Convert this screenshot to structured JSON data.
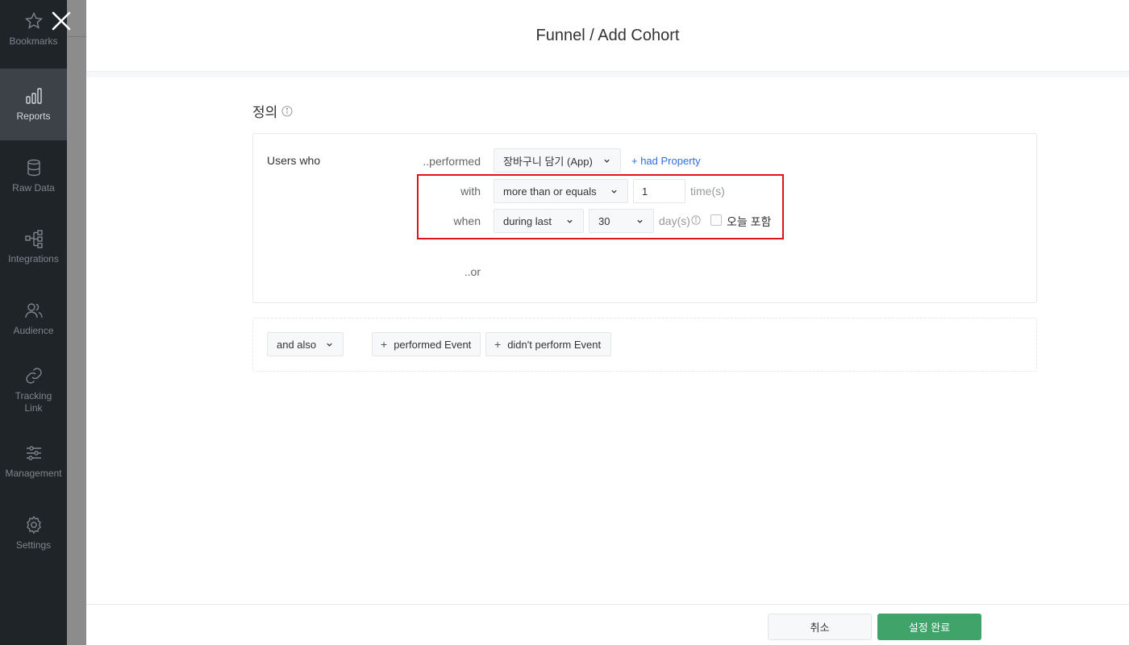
{
  "sidebar": {
    "items": [
      {
        "label": "Bookmarks",
        "icon": "star-icon"
      },
      {
        "label": "Reports",
        "icon": "bar-chart-icon",
        "active": true
      },
      {
        "label": "Raw Data",
        "icon": "database-icon"
      },
      {
        "label": "Integrations",
        "icon": "network-icon"
      },
      {
        "label": "Audience",
        "icon": "users-icon"
      },
      {
        "label": "Tracking Link",
        "icon": "link-icon"
      },
      {
        "label": "Management",
        "icon": "sliders-icon"
      },
      {
        "label": "Settings",
        "icon": "gear-icon"
      }
    ]
  },
  "modal": {
    "title": "Funnel / Add Cohort",
    "section_title": "정의",
    "definition": {
      "users_who": "Users who",
      "performed_label": "..performed",
      "event_select": "장바구니 담기 (App)",
      "had_property": "+ had Property",
      "with_label": "with",
      "operator_select": "more than or equals",
      "count_value": "1",
      "count_unit": "time(s)",
      "when_label": "when",
      "period_select": "during last",
      "days_select": "30",
      "days_unit": "day(s)",
      "include_today_label": "오늘 포함",
      "include_today_checked": false,
      "or_label": "..or"
    },
    "also": {
      "and_also_select": "and also",
      "performed_event_button": "performed Event",
      "didnt_perform_event_button": "didn't perform Event"
    },
    "footer": {
      "cancel_label": "취소",
      "confirm_label": "설정 완료"
    }
  },
  "colors": {
    "sidebar_bg": "#1f2429",
    "accent_green": "#3fa36a",
    "link_blue": "#2f6fde",
    "highlight_red": "#e0121a"
  }
}
